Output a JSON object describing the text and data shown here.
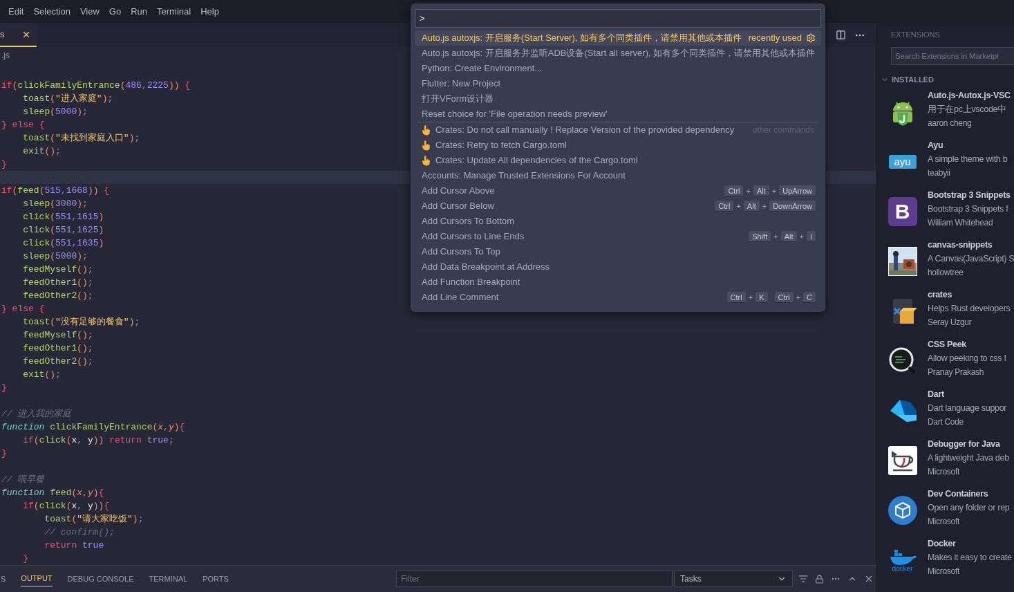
{
  "menu": [
    "Edit",
    "Selection",
    "View",
    "Go",
    "Run",
    "Terminal",
    "Help"
  ],
  "tab": {
    "label": "s",
    "selected": true
  },
  "breadcrumb": ".js",
  "code": [
    {
      "current": false,
      "tokens": [
        {
          "kind": "kw",
          "text": "if"
        },
        {
          "kind": "paren",
          "text": "("
        },
        {
          "kind": "fn",
          "text": "clickFamilyEntrance"
        },
        {
          "kind": "paren",
          "text": "("
        },
        {
          "kind": "num",
          "text": "486"
        },
        {
          "kind": "punct",
          "text": ","
        },
        {
          "kind": "num",
          "text": "2225"
        },
        {
          "kind": "paren",
          "text": "))"
        },
        {
          "kind": "brace",
          "text": " {"
        }
      ]
    },
    {
      "current": false,
      "tokens": [
        {
          "kind": "fn",
          "text": "    toast"
        },
        {
          "kind": "paren",
          "text": "("
        },
        {
          "kind": "str",
          "text": "\"进入家庭\""
        },
        {
          "kind": "paren",
          "text": ")"
        },
        {
          "kind": "punct",
          "text": ";"
        }
      ]
    },
    {
      "current": false,
      "tokens": [
        {
          "kind": "fn",
          "text": "    sleep"
        },
        {
          "kind": "paren",
          "text": "("
        },
        {
          "kind": "num",
          "text": "5000"
        },
        {
          "kind": "paren",
          "text": ")"
        },
        {
          "kind": "punct",
          "text": ";"
        }
      ]
    },
    {
      "current": false,
      "tokens": [
        {
          "kind": "brace",
          "text": "}"
        },
        {
          "kind": "kw",
          "text": " else"
        },
        {
          "kind": "brace",
          "text": " {"
        }
      ]
    },
    {
      "current": false,
      "tokens": [
        {
          "kind": "fn",
          "text": "    toast"
        },
        {
          "kind": "paren",
          "text": "("
        },
        {
          "kind": "str",
          "text": "\"未找到家庭入口\""
        },
        {
          "kind": "paren",
          "text": ")"
        },
        {
          "kind": "punct",
          "text": ";"
        }
      ]
    },
    {
      "current": false,
      "tokens": [
        {
          "kind": "fn",
          "text": "    exit"
        },
        {
          "kind": "paren",
          "text": "()"
        },
        {
          "kind": "punct",
          "text": ";"
        }
      ]
    },
    {
      "current": false,
      "tokens": [
        {
          "kind": "brace",
          "text": "}"
        }
      ]
    },
    {
      "current": true
    },
    {
      "current": false,
      "tokens": [
        {
          "kind": "kw",
          "text": "if"
        },
        {
          "kind": "paren",
          "text": "("
        },
        {
          "kind": "fn",
          "text": "feed"
        },
        {
          "kind": "paren",
          "text": "("
        },
        {
          "kind": "num",
          "text": "515"
        },
        {
          "kind": "punct",
          "text": ","
        },
        {
          "kind": "num",
          "text": "1668"
        },
        {
          "kind": "paren",
          "text": "))"
        },
        {
          "kind": "brace",
          "text": " {"
        }
      ]
    },
    {
      "current": false,
      "tokens": [
        {
          "kind": "fn",
          "text": "    sleep"
        },
        {
          "kind": "paren",
          "text": "("
        },
        {
          "kind": "num",
          "text": "3000"
        },
        {
          "kind": "paren",
          "text": ")"
        },
        {
          "kind": "punct",
          "text": ";"
        }
      ]
    },
    {
      "current": false,
      "tokens": [
        {
          "kind": "fn",
          "text": "    click"
        },
        {
          "kind": "paren",
          "text": "("
        },
        {
          "kind": "num",
          "text": "551"
        },
        {
          "kind": "punct",
          "text": ","
        },
        {
          "kind": "num",
          "text": "1615"
        },
        {
          "kind": "paren",
          "text": ")"
        }
      ]
    },
    {
      "current": false,
      "tokens": [
        {
          "kind": "fn",
          "text": "    click"
        },
        {
          "kind": "paren",
          "text": "("
        },
        {
          "kind": "num",
          "text": "551"
        },
        {
          "kind": "punct",
          "text": ","
        },
        {
          "kind": "num",
          "text": "1625"
        },
        {
          "kind": "paren",
          "text": ")"
        }
      ]
    },
    {
      "current": false,
      "tokens": [
        {
          "kind": "fn",
          "text": "    click"
        },
        {
          "kind": "paren",
          "text": "("
        },
        {
          "kind": "num",
          "text": "551"
        },
        {
          "kind": "punct",
          "text": ","
        },
        {
          "kind": "num",
          "text": "1635"
        },
        {
          "kind": "paren",
          "text": ")"
        }
      ]
    },
    {
      "current": false,
      "tokens": [
        {
          "kind": "fn",
          "text": "    sleep"
        },
        {
          "kind": "paren",
          "text": "("
        },
        {
          "kind": "num",
          "text": "5000"
        },
        {
          "kind": "paren",
          "text": ")"
        },
        {
          "kind": "punct",
          "text": ";"
        }
      ]
    },
    {
      "current": false,
      "tokens": [
        {
          "kind": "fn",
          "text": "    feedMyself"
        },
        {
          "kind": "paren",
          "text": "()"
        },
        {
          "kind": "punct",
          "text": ";"
        }
      ]
    },
    {
      "current": false,
      "tokens": [
        {
          "kind": "fn",
          "text": "    feedOther1"
        },
        {
          "kind": "paren",
          "text": "()"
        },
        {
          "kind": "punct",
          "text": ";"
        }
      ]
    },
    {
      "current": false,
      "tokens": [
        {
          "kind": "fn",
          "text": "    feedOther2"
        },
        {
          "kind": "paren",
          "text": "()"
        },
        {
          "kind": "punct",
          "text": ";"
        }
      ]
    },
    {
      "current": false,
      "tokens": [
        {
          "kind": "brace",
          "text": "}"
        },
        {
          "kind": "kw",
          "text": " else"
        },
        {
          "kind": "brace",
          "text": " {"
        }
      ]
    },
    {
      "current": false,
      "tokens": [
        {
          "kind": "fn",
          "text": "    toast"
        },
        {
          "kind": "paren",
          "text": "("
        },
        {
          "kind": "str",
          "text": "\"没有足够的餐食\""
        },
        {
          "kind": "paren",
          "text": ")"
        },
        {
          "kind": "punct",
          "text": ";"
        }
      ]
    },
    {
      "current": false,
      "tokens": [
        {
          "kind": "fn",
          "text": "    feedMyself"
        },
        {
          "kind": "paren",
          "text": "()"
        },
        {
          "kind": "punct",
          "text": ";"
        }
      ]
    },
    {
      "current": false,
      "tokens": [
        {
          "kind": "fn",
          "text": "    feedOther1"
        },
        {
          "kind": "paren",
          "text": "()"
        },
        {
          "kind": "punct",
          "text": ";"
        }
      ]
    },
    {
      "current": false,
      "tokens": [
        {
          "kind": "fn",
          "text": "    feedOther2"
        },
        {
          "kind": "paren",
          "text": "()"
        },
        {
          "kind": "punct",
          "text": ";"
        }
      ]
    },
    {
      "current": false,
      "tokens": [
        {
          "kind": "fn",
          "text": "    exit"
        },
        {
          "kind": "paren",
          "text": "()"
        },
        {
          "kind": "punct",
          "text": ";"
        }
      ]
    },
    {
      "current": false,
      "tokens": [
        {
          "kind": "brace",
          "text": "}"
        }
      ]
    },
    {
      "current": false
    },
    {
      "current": false,
      "tokens": [
        {
          "kind": "comment",
          "text": "// 进入我的家庭"
        }
      ]
    },
    {
      "current": false,
      "tokens": [
        {
          "kind": "storage",
          "text": "function"
        },
        {
          "kind": "fn",
          "text": " clickFamilyEntrance"
        },
        {
          "kind": "paren",
          "text": "("
        },
        {
          "kind": "param",
          "text": "x"
        },
        {
          "kind": "punct",
          "text": ","
        },
        {
          "kind": "param",
          "text": "y"
        },
        {
          "kind": "paren",
          "text": ")"
        },
        {
          "kind": "brace",
          "text": "{"
        }
      ]
    },
    {
      "current": false,
      "tokens": [
        {
          "kind": "kw",
          "text": "    if"
        },
        {
          "kind": "paren",
          "text": "("
        },
        {
          "kind": "fn",
          "text": "click"
        },
        {
          "kind": "paren",
          "text": "("
        },
        {
          "kind": "var",
          "text": "x"
        },
        {
          "kind": "punct",
          "text": ","
        },
        {
          "kind": "var",
          "text": " y"
        },
        {
          "kind": "paren",
          "text": "))"
        },
        {
          "kind": "kw",
          "text": " return"
        },
        {
          "kind": "bool",
          "text": " true"
        },
        {
          "kind": "punct",
          "text": ";"
        }
      ]
    },
    {
      "current": false,
      "tokens": [
        {
          "kind": "brace",
          "text": "}"
        }
      ]
    },
    {
      "current": false
    },
    {
      "current": false,
      "tokens": [
        {
          "kind": "comment",
          "text": "// 喂早餐"
        }
      ]
    },
    {
      "current": false,
      "tokens": [
        {
          "kind": "storage",
          "text": "function"
        },
        {
          "kind": "fn",
          "text": " feed"
        },
        {
          "kind": "paren",
          "text": "("
        },
        {
          "kind": "param",
          "text": "x"
        },
        {
          "kind": "punct",
          "text": ","
        },
        {
          "kind": "param",
          "text": "y"
        },
        {
          "kind": "paren",
          "text": ")"
        },
        {
          "kind": "brace",
          "text": "{"
        }
      ]
    },
    {
      "current": false,
      "tokens": [
        {
          "kind": "kw",
          "text": "    if"
        },
        {
          "kind": "paren",
          "text": "("
        },
        {
          "kind": "fn",
          "text": "click"
        },
        {
          "kind": "paren",
          "text": "("
        },
        {
          "kind": "var",
          "text": "x"
        },
        {
          "kind": "punct",
          "text": ","
        },
        {
          "kind": "var",
          "text": " y"
        },
        {
          "kind": "paren",
          "text": "))"
        },
        {
          "kind": "brace",
          "text": "{"
        }
      ]
    },
    {
      "current": false,
      "tokens": [
        {
          "kind": "fn",
          "text": "        toast"
        },
        {
          "kind": "paren",
          "text": "("
        },
        {
          "kind": "str",
          "text": "\"请大家吃饭\""
        },
        {
          "kind": "paren",
          "text": ")"
        },
        {
          "kind": "punct",
          "text": ";"
        }
      ]
    },
    {
      "current": false,
      "tokens": [
        {
          "kind": "comment",
          "text": "        // confirm();"
        }
      ]
    },
    {
      "current": false,
      "tokens": [
        {
          "kind": "kw",
          "text": "        return"
        },
        {
          "kind": "bool",
          "text": " true"
        }
      ]
    },
    {
      "current": false,
      "tokens": [
        {
          "kind": "brace",
          "text": "    }"
        }
      ]
    }
  ],
  "palette": {
    "value": ">",
    "commands": [
      {
        "label": "Auto.js autoxjs: 开启服务(Start Server), 如有多个同类插件，请禁用其他或本插件",
        "kind": "plain",
        "selected": true,
        "detail": "recently used"
      },
      {
        "label": "Auto.js autoxjs: 开启服务并监听ADB设备(Start all server), 如有多个同类插件，请禁用其他或本插件",
        "kind": "plain",
        "selected": false
      },
      {
        "label": "Python: Create Environment...",
        "kind": "plain",
        "selected": false
      },
      {
        "label": "Flutter: New Project",
        "kind": "plain",
        "selected": false
      },
      {
        "label": "打开VForm设计器",
        "kind": "plain",
        "selected": false
      },
      {
        "label": "Reset choice for 'File operation needs preview'",
        "kind": "plain",
        "selected": false
      },
      {
        "label": "Crates: Do not call manually ! Replace Version of the provided dependency",
        "kind": "pointer",
        "selected": false,
        "group": "other commands"
      },
      {
        "label": "Crates: Retry to fetch Cargo.toml",
        "kind": "pointer",
        "selected": false
      },
      {
        "label": "Crates: Update All dependencies of the Cargo.toml",
        "kind": "pointer",
        "selected": false
      },
      {
        "label": "Accounts: Manage Trusted Extensions For Account",
        "kind": "plain",
        "selected": false
      },
      {
        "label": "Add Cursor Above",
        "kind": "plain",
        "selected": false,
        "keys": [
          [
            "Ctrl",
            "+",
            "Alt",
            "+",
            "UpArrow"
          ]
        ]
      },
      {
        "label": "Add Cursor Below",
        "kind": "plain",
        "selected": false,
        "keys": [
          [
            "Ctrl",
            "+",
            "Alt",
            "+",
            "DownArrow"
          ]
        ]
      },
      {
        "label": "Add Cursors To Bottom",
        "kind": "plain",
        "selected": false
      },
      {
        "label": "Add Cursors to Line Ends",
        "kind": "plain",
        "selected": false,
        "keys": [
          [
            "Shift",
            "+",
            "Alt",
            "+",
            "I"
          ]
        ]
      },
      {
        "label": "Add Cursors To Top",
        "kind": "plain",
        "selected": false
      },
      {
        "label": "Add Data Breakpoint at Address",
        "kind": "plain",
        "selected": false
      },
      {
        "label": "Add Function Breakpoint",
        "kind": "plain",
        "selected": false
      },
      {
        "label": "Add Line Comment",
        "kind": "plain",
        "selected": false,
        "keys": [
          [
            "Ctrl",
            "+",
            "K"
          ],
          [
            "Ctrl",
            "+",
            "C"
          ]
        ]
      }
    ]
  },
  "extensions": {
    "title": "EXTENSIONS",
    "search_placeholder": "Search Extensions in Marketpl",
    "section": "INSTALLED",
    "expanded": true,
    "items": [
      {
        "name": "Auto.js-Autox.js-VSC",
        "description": "用于在pc上vscode中",
        "publisher": "aaron cheng",
        "kind": "android"
      },
      {
        "name": "Ayu",
        "description": "A simple theme with b",
        "publisher": "teabyii",
        "kind": "ayu",
        "icon_label": "ayu"
      },
      {
        "name": "Bootstrap 3 Snippets",
        "description": "Bootstrap 3 Snippets f",
        "publisher": "William Whitehead",
        "kind": "bootstrap",
        "icon_label": "B"
      },
      {
        "name": "canvas-snippets",
        "description": "A Canvas(JavaScript) S",
        "publisher": "hollowtree",
        "kind": "picture"
      },
      {
        "name": "crates",
        "description": "Helps Rust developers",
        "publisher": "Seray Uzgur",
        "kind": "crates"
      },
      {
        "name": "CSS Peek",
        "description": "Allow peeking to css I",
        "publisher": "Pranay Prakash",
        "kind": "magnifier"
      },
      {
        "name": "Dart",
        "description": "Dart language suppor",
        "publisher": "Dart Code",
        "kind": "dart"
      },
      {
        "name": "Debugger for Java",
        "description": "A lightweight Java deb",
        "publisher": "Microsoft",
        "kind": "java"
      },
      {
        "name": "Dev Containers",
        "description": "Open any folder or rep",
        "publisher": "Microsoft",
        "kind": "container"
      },
      {
        "name": "Docker",
        "description": "Makes it easy to create",
        "publisher": "Microsoft",
        "kind": "docker",
        "icon_label": "docker"
      }
    ]
  },
  "panel": {
    "tabs": [
      {
        "label": "S",
        "selected": false
      },
      {
        "label": "OUTPUT",
        "selected": true
      },
      {
        "label": "DEBUG CONSOLE",
        "selected": false
      },
      {
        "label": "TERMINAL",
        "selected": false
      },
      {
        "label": "PORTS",
        "selected": false
      }
    ],
    "filter_placeholder": "Filter",
    "channel": "Tasks"
  }
}
